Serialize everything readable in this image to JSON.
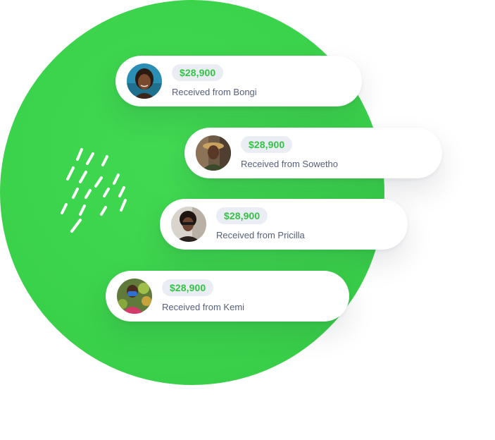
{
  "transactions": [
    {
      "amount": "$28,900",
      "label": "Received from Bongi"
    },
    {
      "amount": "$28,900",
      "label": "Received from Sowetho"
    },
    {
      "amount": "$28,900",
      "label": "Received from Pricilla"
    },
    {
      "amount": "$28,900",
      "label": "Received from Kemi"
    }
  ],
  "colors": {
    "accent_green": "#3bd24b",
    "amount_text": "#35c246",
    "amount_pill": "#ebedf4",
    "label_text": "#56607a",
    "card_bg": "#ffffff"
  },
  "icons": {
    "decoration": "brush-strokes-icon",
    "avatar": "avatar-photo"
  }
}
